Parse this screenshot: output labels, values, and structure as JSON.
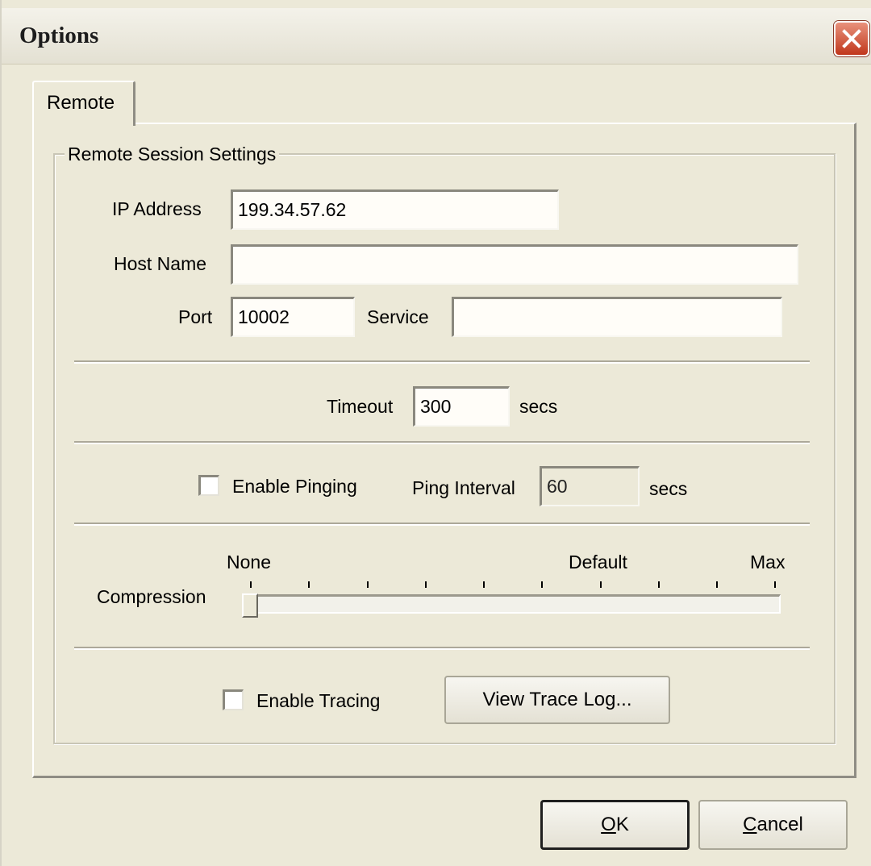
{
  "window": {
    "title": "Options"
  },
  "tabs": [
    {
      "label": "Remote",
      "selected": true
    }
  ],
  "remote_session": {
    "group_label": "Remote Session Settings",
    "ip_address": {
      "label": "IP Address",
      "value": "199.34.57.62"
    },
    "host_name": {
      "label": "Host Name",
      "value": ""
    },
    "port": {
      "label": "Port",
      "value": "10002"
    },
    "service": {
      "label": "Service",
      "value": ""
    },
    "timeout": {
      "label": "Timeout",
      "value": "300",
      "unit": "secs"
    },
    "pinging": {
      "checkbox_label": "Enable Pinging",
      "checked": false,
      "interval_label": "Ping Interval",
      "interval_value": "60",
      "interval_unit": "secs"
    },
    "compression": {
      "label": "Compression",
      "min_label": "None",
      "mid_label": "Default",
      "max_label": "Max",
      "tick_count": 10,
      "level": 0
    },
    "tracing": {
      "checkbox_label": "Enable Tracing",
      "checked": false,
      "view_log_button": "View Trace Log..."
    }
  },
  "buttons": {
    "ok_mnemonic": "O",
    "ok_rest": "K",
    "cancel_mnemonic": "C",
    "cancel_rest": "ancel"
  },
  "colors": {
    "dialog_bg": "#ece9d8",
    "close_button": "#c1371c"
  },
  "icons": {
    "close": "close-icon"
  }
}
